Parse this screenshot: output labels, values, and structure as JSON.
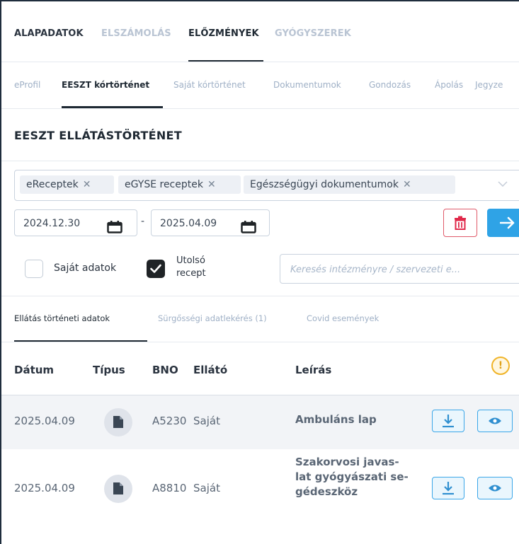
{
  "top_tabs": [
    {
      "label": "ALAPADATOK",
      "state": "normal"
    },
    {
      "label": "ELSZÁMOLÁS",
      "state": "inactive"
    },
    {
      "label": "ELŐZMÉNYEK",
      "state": "active"
    },
    {
      "label": "GYÓGYSZEREK",
      "state": "inactive"
    }
  ],
  "sub_tabs": [
    {
      "label": "eProfil",
      "state": "inactive"
    },
    {
      "label": "EESZT kórtörténet",
      "state": "active"
    },
    {
      "label": "Saját kórtörténet",
      "state": "inactive"
    },
    {
      "label": "Dokumentumok",
      "state": "inactive"
    },
    {
      "label": "Gondozás",
      "state": "inactive"
    },
    {
      "label": "Ápolás",
      "state": "inactive"
    },
    {
      "label": "Jegyze",
      "state": "inactive"
    }
  ],
  "section_title": "EESZT ELLÁTÁSTÖRTÉNET",
  "filter_tags": [
    "eReceptek",
    "eGYSE receptek",
    "Egészségügyi dokumentumok"
  ],
  "tag_remove_glyph": "✕",
  "date_from": "2024.12.30",
  "date_separator": "-",
  "date_to": "2025.04.09",
  "checkbox_own": {
    "label": "Saját adatok",
    "checked": false
  },
  "checkbox_last": {
    "label_line1": "Utolsó",
    "label_line2": "recept",
    "checked": true
  },
  "search_placeholder": "Keresés intézményre / szervezeti e...",
  "data_tabs": [
    {
      "label": "Ellátás történeti adatok",
      "state": "active"
    },
    {
      "label": "Sürgősségi adatlekérés (1)",
      "state": "inactive"
    },
    {
      "label": "Covid események",
      "state": "inactive"
    }
  ],
  "table": {
    "headers": {
      "date": "Dátum",
      "type": "Típus",
      "bno": "BNO",
      "provider": "Ellátó",
      "description": "Leírás"
    },
    "warning_glyph": "!",
    "rows": [
      {
        "date": "2025.04.09",
        "bno": "A5230",
        "provider": "Saját",
        "desc_lines": [
          "Ambuláns lap"
        ]
      },
      {
        "date": "2025.04.09",
        "bno": "A8810",
        "provider": "Saját",
        "desc_lines": [
          "Szakorvosi javas-",
          "lat gyógyászati se-",
          "gédeszköz"
        ]
      }
    ]
  },
  "colors": {
    "accent": "#2fa3e6",
    "danger": "#e05a6a",
    "warning": "#f0b429",
    "inactive_text": "#9fb0c6"
  },
  "icons": [
    "calendar-icon",
    "trash-icon",
    "arrow-right-icon",
    "check-icon",
    "document-icon",
    "download-icon",
    "eye-icon",
    "warning-icon",
    "chevron-down-icon",
    "close-icon"
  ]
}
